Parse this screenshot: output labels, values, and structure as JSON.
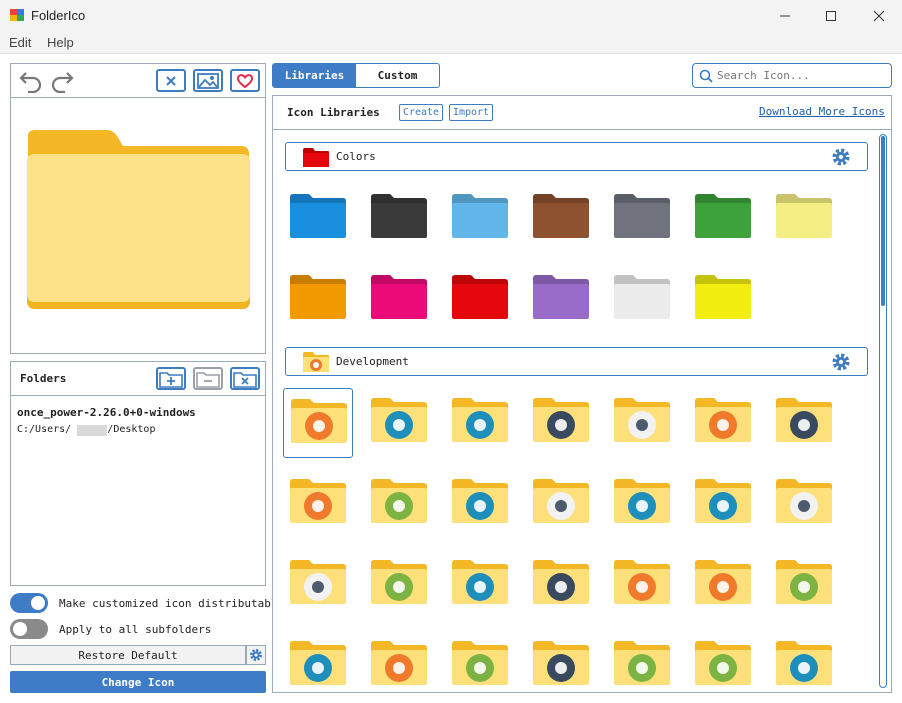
{
  "window": {
    "title": "FolderIco"
  },
  "menu": {
    "items": [
      "Edit",
      "Help"
    ]
  },
  "folders_panel": {
    "title": "Folders",
    "entry_name": "once_power-2.26.0+0-windows",
    "entry_path": "C:/Users/      /Desktop"
  },
  "options": {
    "distributable_label": "Make customized icon distributable",
    "distributable_on": true,
    "subfolders_label": "Apply to all subfolders",
    "subfolders_on": false
  },
  "buttons": {
    "restore": "Restore Default",
    "change": "Change Icon"
  },
  "tabs": [
    {
      "label": "Libraries",
      "active": true
    },
    {
      "label": "Custom",
      "active": false
    }
  ],
  "search": {
    "placeholder": "Search Icon..."
  },
  "library": {
    "title": "Icon Libraries",
    "create": "Create",
    "import": "Import",
    "download_link": "Download More Icons"
  },
  "sections": [
    {
      "label": "Colors",
      "icon": "red-folder-icon",
      "colors": [
        "#1a8fe0",
        "#3a3a3a",
        "#62b7ea",
        "#8e5230",
        "#70737e",
        "#3da23a",
        "#f5ee84",
        "#f29a00",
        "#ea0b78",
        "#e5070b",
        "#9a6cca",
        "#ececec",
        "#f2ee10"
      ]
    },
    {
      "label": "Development",
      "icon": "development-folder-icon",
      "badges": [
        [
          "#f07a2b",
          "alarm-clock-icon"
        ],
        [
          "#1d8fba",
          "toolbox-icon"
        ],
        [
          "#1d8fba",
          "gear-sun-icon"
        ],
        [
          "#3a4a5e",
          "camera-icon"
        ],
        [
          "#f2f2f2",
          "tablet-icon"
        ],
        [
          "#f07a2b",
          "cloud-icon"
        ],
        [
          "#3a4a5e",
          "gear-icon"
        ],
        [
          "#f07a2b",
          "stopwatch-icon"
        ],
        [
          "#7cb342",
          "presentation-icon"
        ],
        [
          "#1d8fba",
          "easel-icon"
        ],
        [
          "#f2f2f2",
          "traffic-cone-icon"
        ],
        [
          "#1d8fba",
          "crown-icon"
        ],
        [
          "#1d8fba",
          "diamond-icon"
        ],
        [
          "#f2f2f2",
          "dice-icon"
        ],
        [
          "#f2f2f2",
          "cross-icon"
        ],
        [
          "#7cb342",
          "puzzle-icon"
        ],
        [
          "#1d8fba",
          "factory-icon"
        ],
        [
          "#3a4a5e",
          "flask-icon"
        ],
        [
          "#f07a2b",
          "gamepad-icon"
        ],
        [
          "#f07a2b",
          "hierarchy-icon"
        ],
        [
          "#7cb342",
          "bug-icon"
        ],
        [
          "#1d8fba",
          "chart-icon"
        ],
        [
          "#f07a2b",
          "bolt-icon"
        ],
        [
          "#7cb342",
          "leaf-icon"
        ],
        [
          "#3a4a5e",
          "link-icon"
        ],
        [
          "#7cb342",
          "gear-icon"
        ],
        [
          "#7cb342",
          "microscope-icon"
        ],
        [
          "#1d8fba",
          "dropbox-icon"
        ]
      ]
    }
  ],
  "colors": {
    "accent": "#3f7cc7",
    "folder_light": "#fde07a",
    "folder_dark": "#f4b826"
  }
}
